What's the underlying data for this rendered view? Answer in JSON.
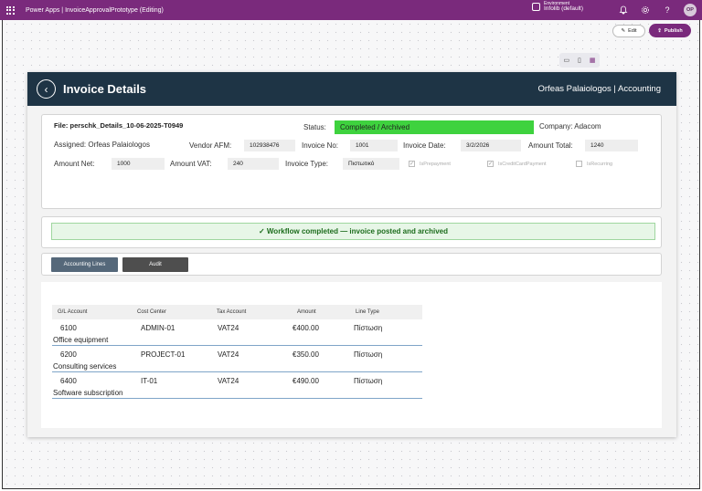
{
  "topbar": {
    "title": "Power Apps  |  InvoiceApprovalPrototype (Editing)",
    "env_label": "Environment",
    "env_value": "Infolib (default)",
    "avatar": "OP"
  },
  "studio": {
    "edit_label": "Edit",
    "publish_label": "Publish"
  },
  "header": {
    "title": "Invoice Details",
    "right_text": "Orfeas Palaiologos | Accounting"
  },
  "invoice": {
    "file": "File: perschk_Details_10-06-2025-T0949",
    "status_label": "Status:",
    "status_value": "Completed / Archived",
    "company": "Company: Adacom",
    "assigned": "Assigned: Orfeas Palaiologos",
    "vendor_afm_label": "Vendor AFM:",
    "vendor_afm_value": "102938476",
    "invoice_no_label": "Invoice No:",
    "invoice_no_value": "1001",
    "invoice_date_label": "Invoice Date:",
    "invoice_date_value": "3/2/2026",
    "amount_total_label": "Amount Total:",
    "amount_total_value": "1240",
    "amount_net_label": "Amount Net:",
    "amount_net_value": "1000",
    "amount_vat_label": "Amount VAT:",
    "amount_vat_value": "240",
    "invoice_type_label": "Invoice Type:",
    "invoice_type_value": "Πιστωτικό",
    "checkboxes": [
      {
        "label": "IsPrepayment",
        "checked": true
      },
      {
        "label": "IsCreditCardPayment",
        "checked": true
      },
      {
        "label": "IsRecurring",
        "checked": false
      }
    ]
  },
  "workflow": {
    "message": "✓ Workflow completed — invoice posted and archived"
  },
  "tabs": [
    {
      "label": "Accounting Lines"
    },
    {
      "label": "Audit"
    }
  ],
  "lines_table": {
    "columns": [
      "G/L Account",
      "Cost Center",
      "Tax Account",
      "Amount",
      "Line Type"
    ],
    "rows": [
      {
        "gl": "6100",
        "cost_center": "ADMIN-01",
        "tax": "VAT24",
        "amount": "€400.00",
        "line_type": "Πίστωση",
        "description": "Office equipment"
      },
      {
        "gl": "6200",
        "cost_center": "PROJECT-01",
        "tax": "VAT24",
        "amount": "€350.00",
        "line_type": "Πίστωση",
        "description": "Consulting services"
      },
      {
        "gl": "6400",
        "cost_center": "IT-01",
        "tax": "VAT24",
        "amount": "€490.00",
        "line_type": "Πίστωση",
        "description": "Software subscription"
      }
    ]
  },
  "colors": {
    "topbar": "#7a2a7c",
    "header": "#1e3445",
    "status_green": "#3ed23e",
    "tab_active": "#55687a",
    "tab_inactive": "#4e4e4e"
  }
}
